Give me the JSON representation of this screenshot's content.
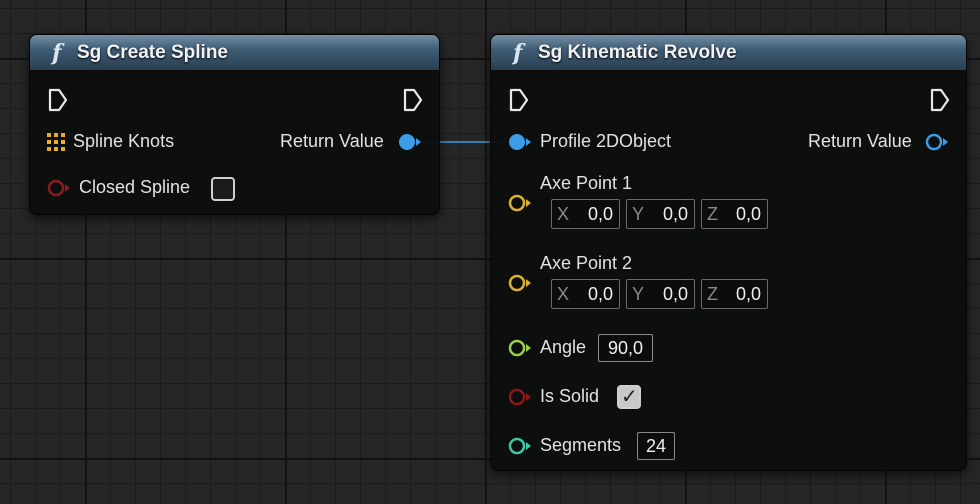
{
  "colors": {
    "header": "#3d5a72",
    "object_pin": "#3b9de8",
    "bool_pin": "#8b1a1a",
    "vector_pin": "#e0b030",
    "float_pin": "#9bd048",
    "int_pin": "#3fc7a6",
    "array_pin": "#e8b020"
  },
  "nodes": {
    "create_spline": {
      "title": "Sg Create Spline",
      "pins": {
        "spline_knots": "Spline Knots",
        "closed_spline": "Closed Spline",
        "return_value": "Return Value"
      },
      "closed_spline_checked": false
    },
    "kinematic_revolve": {
      "title": "Sg Kinematic Revolve",
      "pins": {
        "profile": "Profile 2DObject",
        "return_value": "Return Value",
        "axe_point_1": "Axe Point 1",
        "axe_point_2": "Axe Point 2",
        "angle": "Angle",
        "is_solid": "Is Solid",
        "segments": "Segments"
      },
      "axe_point_1": {
        "x_label": "X",
        "x": "0,0",
        "y_label": "Y",
        "y": "0,0",
        "z_label": "Z",
        "z": "0,0"
      },
      "axe_point_2": {
        "x_label": "X",
        "x": "0,0",
        "y_label": "Y",
        "y": "0,0",
        "z_label": "Z",
        "z": "0,0"
      },
      "angle_value": "90,0",
      "is_solid_checked": true,
      "segments_value": "24"
    }
  },
  "icons": {
    "function": "function-icon",
    "exec": "exec-pin-icon",
    "array": "array-grid-icon"
  },
  "glyphs": {
    "function": "f"
  }
}
